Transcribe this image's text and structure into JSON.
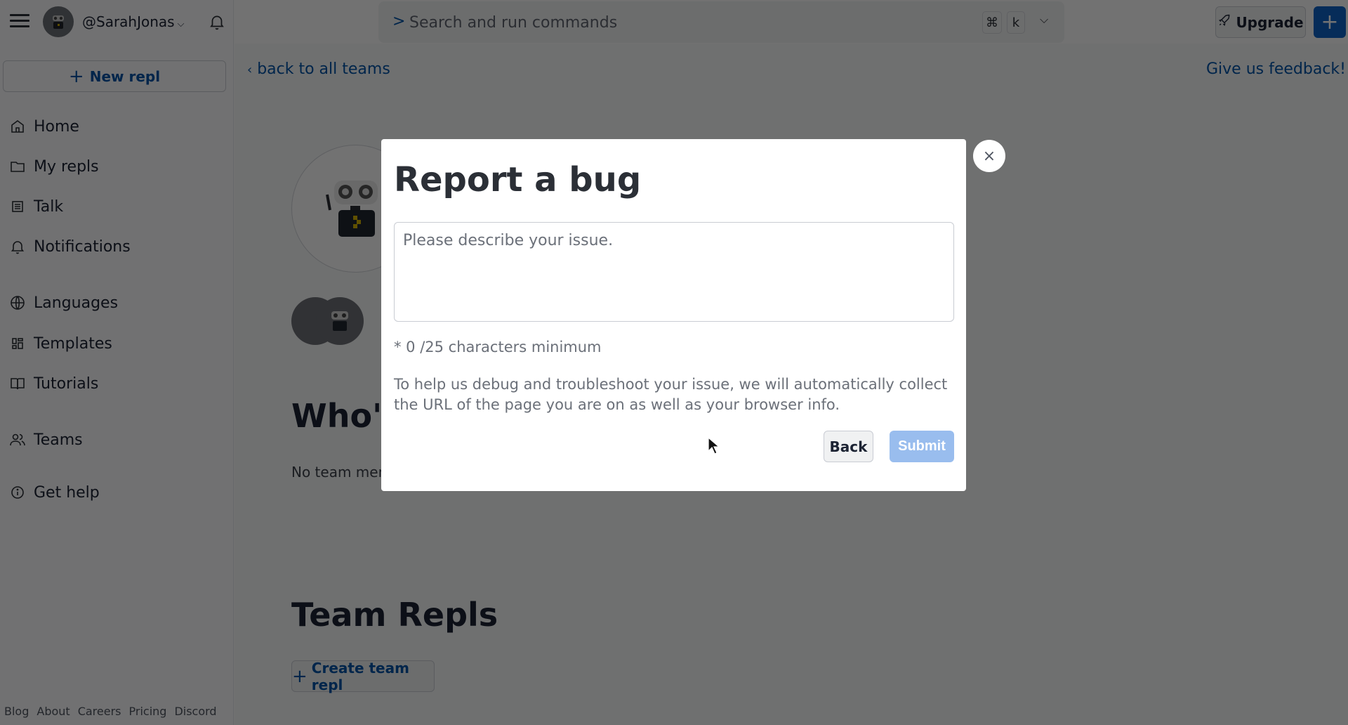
{
  "user": {
    "username": "@SarahJonas"
  },
  "sidebar": {
    "new_repl_label": "New repl",
    "items": [
      {
        "label": "Home",
        "icon": "home-icon"
      },
      {
        "label": "My repls",
        "icon": "folder-icon"
      },
      {
        "label": "Talk",
        "icon": "talk-icon"
      },
      {
        "label": "Notifications",
        "icon": "bell-icon"
      },
      {
        "label": "Languages",
        "icon": "globe-icon"
      },
      {
        "label": "Templates",
        "icon": "templates-icon"
      },
      {
        "label": "Tutorials",
        "icon": "book-icon"
      },
      {
        "label": "Teams",
        "icon": "users-icon"
      },
      {
        "label": "Get help",
        "icon": "info-icon"
      }
    ],
    "footer_links": [
      "Blog",
      "About",
      "Careers",
      "Pricing",
      "Discord"
    ]
  },
  "topbar": {
    "search_prompt": ">",
    "search_placeholder": "Search and run commands",
    "shortcut_keys": [
      "⌘",
      "k"
    ],
    "upgrade_label": "Upgrade"
  },
  "main": {
    "back_link": "back to all teams",
    "feedback_link": "Give us feedback!",
    "who_heading_visible": "Who's",
    "no_members_visible": "No team mem",
    "team_repls_heading": "Team Repls",
    "create_team_repl_label": "Create team repl"
  },
  "modal": {
    "title": "Report a bug",
    "textarea_placeholder": "Please describe your issue.",
    "textarea_value": "",
    "char_count": "* 0 /25 characters minimum",
    "info_text": "To help us debug and troubleshoot your issue, we will automatically collect the URL of the page you are on as well as your browser info.",
    "back_label": "Back",
    "submit_label": "Submit",
    "close_symbol": "×"
  },
  "colors": {
    "accent_blue": "#0053a6",
    "primary_button": "#0f62c6",
    "submit_disabled": "#99bdee"
  }
}
